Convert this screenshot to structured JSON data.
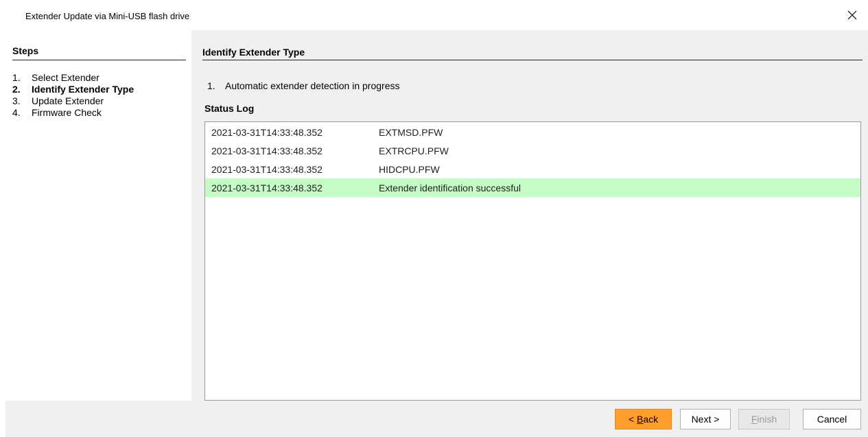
{
  "window": {
    "title": "Extender Update via Mini-USB flash drive"
  },
  "sidebar": {
    "title": "Steps",
    "steps": [
      {
        "num": "1.",
        "label": "Select Extender",
        "active": false
      },
      {
        "num": "2.",
        "label": "Identify Extender Type",
        "active": true
      },
      {
        "num": "3.",
        "label": "Update Extender",
        "active": false
      },
      {
        "num": "4.",
        "label": "Firmware Check",
        "active": false
      }
    ]
  },
  "main": {
    "title": "Identify Extender Type",
    "detect_num": "1.",
    "detect_text": "Automatic extender detection in progress",
    "log_title": "Status Log",
    "log": [
      {
        "time": "2021-03-31T14:33:48.352",
        "message": "EXTMSD.PFW"
      },
      {
        "time": "2021-03-31T14:33:48.352",
        "message": "EXTRCPU.PFW"
      },
      {
        "time": "2021-03-31T14:33:48.352",
        "message": "HIDCPU.PFW"
      },
      {
        "time": "2021-03-31T14:33:48.352",
        "message": "Extender identification successful"
      }
    ]
  },
  "footer": {
    "back_prefix": "< ",
    "back_mnemonic": "B",
    "back_rest": "ack",
    "next_label": "Next >",
    "finish_mnemonic": "F",
    "finish_rest": "inish",
    "cancel_label": "Cancel"
  },
  "colors": {
    "back_button": "#ff9e2c",
    "success_row": "#c5fbc5",
    "panel_bg": "#f0f0f0"
  }
}
